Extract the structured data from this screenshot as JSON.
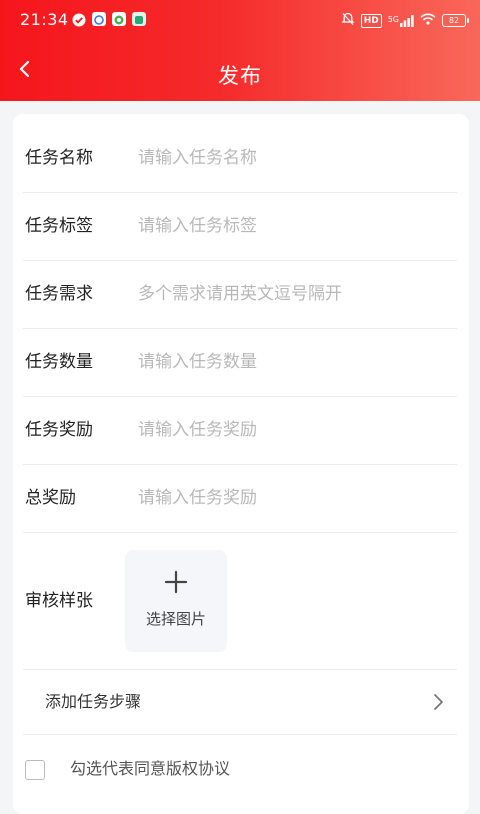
{
  "status_bar": {
    "time": "21:34",
    "network": "5G",
    "hd_badge": "HD",
    "battery": "82",
    "icons": [
      "check-circle-icon",
      "app-notification-icon",
      "app-notification-icon",
      "app-notification-icon",
      "bell-off-icon",
      "signal-icon",
      "wifi-icon",
      "battery-icon"
    ]
  },
  "header": {
    "title": "发布",
    "back_icon": "chevron-left-icon",
    "gradient_colors": [
      "#f5161c",
      "#f9685a"
    ]
  },
  "form": {
    "fields": [
      {
        "label": "任务名称",
        "placeholder": "请输入任务名称",
        "value": ""
      },
      {
        "label": "任务标签",
        "placeholder": "请输入任务标签",
        "value": ""
      },
      {
        "label": "任务需求",
        "placeholder": "多个需求请用英文逗号隔开",
        "value": ""
      },
      {
        "label": "任务数量",
        "placeholder": "请输入任务数量",
        "value": ""
      },
      {
        "label": "任务奖励",
        "placeholder": "请输入任务奖励",
        "value": ""
      },
      {
        "label": "总奖励",
        "placeholder": "请输入任务奖励",
        "value": ""
      }
    ],
    "sample_image": {
      "label": "审核样张",
      "upload_label": "选择图片",
      "upload_icon": "plus-icon"
    },
    "steps": {
      "label": "添加任务步骤",
      "icon": "chevron-right-icon"
    },
    "agreement": {
      "label": "勾选代表同意版权协议",
      "checked": false
    }
  }
}
